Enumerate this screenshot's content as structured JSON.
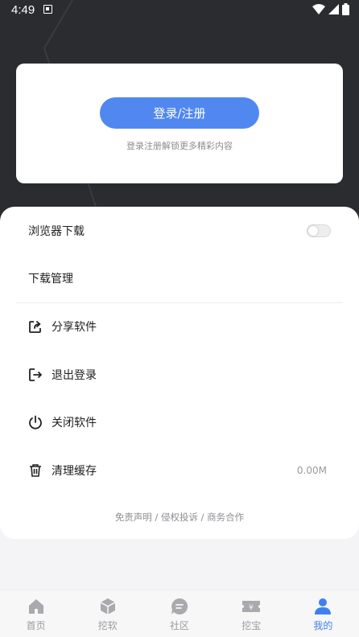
{
  "status_bar": {
    "time": "4:49"
  },
  "login_card": {
    "button_label": "登录/注册",
    "subtitle": "登录注册解锁更多精彩内容"
  },
  "settings": {
    "browser_download": {
      "label": "浏览器下载",
      "enabled": false
    },
    "download_manager": {
      "label": "下载管理"
    },
    "share": {
      "label": "分享软件",
      "icon": "share-icon"
    },
    "logout": {
      "label": "退出登录",
      "icon": "logout-icon"
    },
    "close_app": {
      "label": "关闭软件",
      "icon": "power-icon"
    },
    "clear_cache": {
      "label": "清理缓存",
      "icon": "trash-icon",
      "size": "0.00M"
    }
  },
  "footer_links": "免责声明 / 侵权投诉 / 商务合作",
  "tabbar": {
    "active": "我的",
    "items": [
      {
        "label": "首页",
        "icon": "home-icon"
      },
      {
        "label": "挖软",
        "icon": "box-icon"
      },
      {
        "label": "社区",
        "icon": "chat-icon"
      },
      {
        "label": "挖宝",
        "icon": "ticket-icon"
      },
      {
        "label": "我的",
        "icon": "user-icon"
      }
    ]
  },
  "colors": {
    "accent": "#5088f0",
    "tab_active": "#3f7ff0",
    "hero_bg": "#2b2c30"
  }
}
